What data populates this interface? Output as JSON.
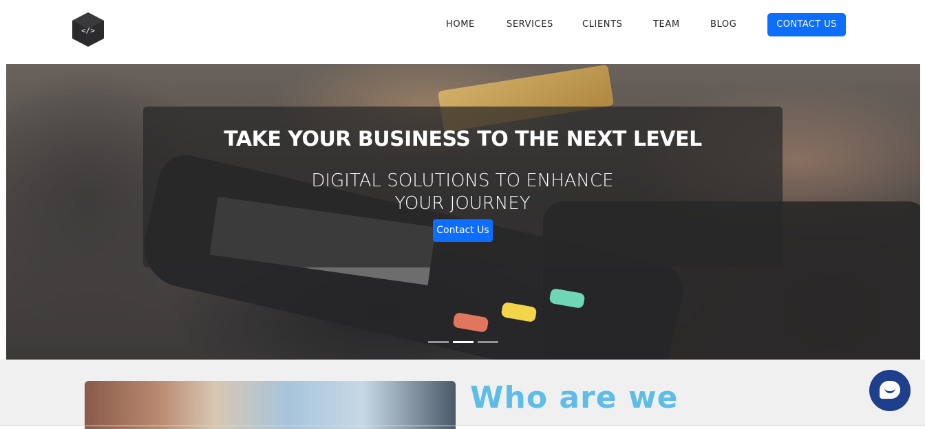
{
  "brand": {
    "logo_icon": "code-cube-icon"
  },
  "nav": {
    "items": [
      {
        "label": "HOME"
      },
      {
        "label": "SERVICES"
      },
      {
        "label": "CLIENTS"
      },
      {
        "label": "TEAM"
      },
      {
        "label": "BLOG"
      }
    ],
    "cta_label": "CONTACT US"
  },
  "hero": {
    "title": "TAKE YOUR BUSINESS TO THE NEXT LEVEL",
    "subtitle_line1": "DIGITAL SOLUTIONS TO ENHANCE",
    "subtitle_line2": "YOUR JOURNEY",
    "button_label": "Contact Us",
    "slides_total": 3,
    "active_slide": 2
  },
  "about": {
    "title": "Who are we"
  },
  "chat": {
    "icon": "chat-bubble-icon"
  },
  "colors": {
    "accent": "#0d6efd",
    "heading_blue": "#5ebde6",
    "chat_bg": "#1e3f8c"
  }
}
